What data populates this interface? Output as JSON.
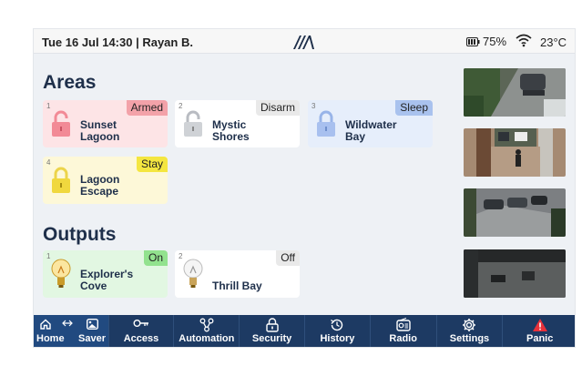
{
  "status": {
    "datetime": "Tue 16 Jul 14:30 | Rayan B.",
    "battery": "75%",
    "temperature": "23°C"
  },
  "areas_title": "Areas",
  "outputs_title": "Outputs",
  "areas": [
    {
      "num": "1",
      "name1": "Sunset",
      "name2": "Lagoon",
      "state": "Armed",
      "bg": "#fde4e6",
      "badge": "#f3a2a9",
      "icon": "#f28a96"
    },
    {
      "num": "2",
      "name1": "Mystic",
      "name2": "Shores",
      "state": "Disarm",
      "bg": "#ffffff",
      "badge": "#e9e9e9",
      "icon": "#b9bcc2"
    },
    {
      "num": "3",
      "name1": "Wildwater",
      "name2": "Bay",
      "state": "Sleep",
      "bg": "#e6eefb",
      "badge": "#a9c2ee",
      "icon": "#98b4e8"
    },
    {
      "num": "4",
      "name1": "Lagoon",
      "name2": "Escape",
      "state": "Stay",
      "bg": "#fdf8d8",
      "badge": "#f4e640",
      "icon": "#ecd44a"
    }
  ],
  "outputs": [
    {
      "num": "1",
      "name1": "Explorer's",
      "name2": "Cove",
      "state": "On",
      "bg": "#e2f7e2",
      "badge": "#92e28e"
    },
    {
      "num": "2",
      "name1": "Thrill Bay",
      "name2": "",
      "state": "Off",
      "bg": "#ffffff",
      "badge": "#e9e9e9"
    }
  ],
  "nav": {
    "home": "Home",
    "saver": "Saver",
    "access": "Access",
    "automation": "Automation",
    "security": "Security",
    "history": "History",
    "radio": "Radio",
    "settings": "Settings",
    "panic": "Panic"
  },
  "colors": {
    "navbar": "#1d3a63",
    "title": "#1e2f4a",
    "panic": "#e8313a"
  }
}
